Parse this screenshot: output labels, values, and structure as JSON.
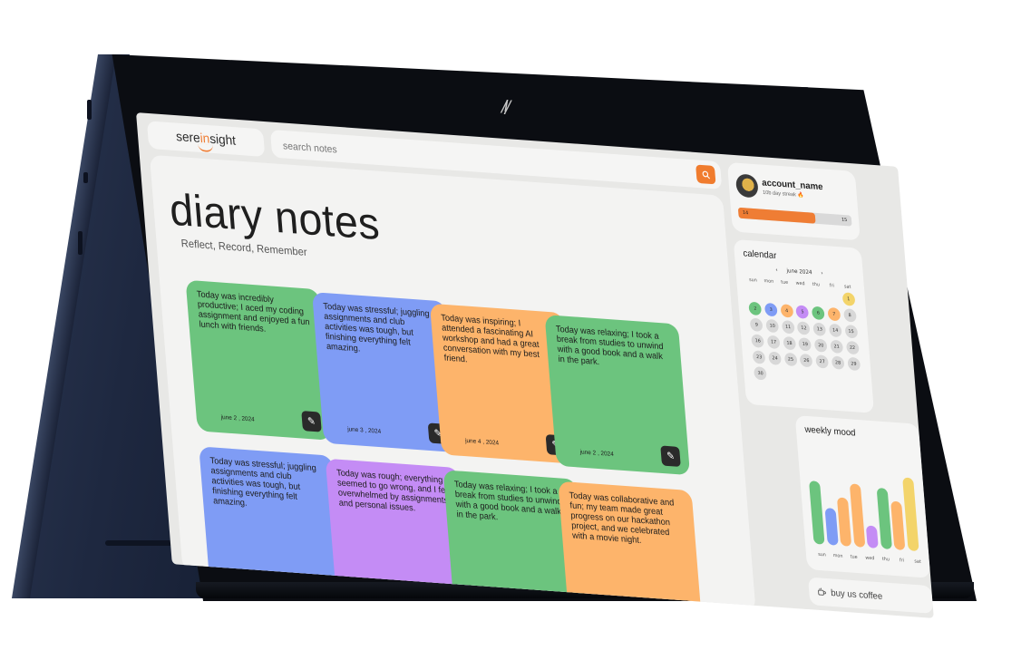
{
  "header": {
    "brand": {
      "pre": "sere",
      "mid": "in",
      "post": "sight"
    },
    "search_placeholder": "search notes",
    "search_icon": "search-icon"
  },
  "main": {
    "title": "diary notes",
    "subtitle": "Reflect, Record, Remember",
    "notes": [
      {
        "text": "Today was incredibly productive; I aced my coding assignment and enjoyed a fun lunch with friends.",
        "date": "june 2 , 2024",
        "color": "#6cc47e"
      },
      {
        "text": "Today was stressful; juggling assignments and club activities was tough, but finishing everything felt amazing.",
        "date": "june 3 , 2024",
        "color": "#7f9cf5"
      },
      {
        "text": "Today was inspiring; I attended a fascinating AI workshop and had a great conversation with my best friend.",
        "date": "june 4 , 2024",
        "color": "#fdb46b"
      },
      {
        "text": "Today was relaxing; I took a break from studies to unwind with a good book and a walk in the park.",
        "date": "june 2 , 2024",
        "color": "#6cc47e"
      },
      {
        "text": "Today was stressful; juggling assignments and club activities was tough, but finishing everything felt amazing.",
        "date": "",
        "color": "#7f9cf5"
      },
      {
        "text": "Today was rough; everything seemed to go wrong, and I felt overwhelmed by assignments and personal issues.",
        "date": "",
        "color": "#c48cf5"
      },
      {
        "text": "Today was relaxing; I took a break from studies to unwind with a good book and a walk in the park.",
        "date": "",
        "color": "#6cc47e"
      },
      {
        "text": "Today was collaborative and fun; my team made great progress on our hackathon project, and we celebrated with a movie night.",
        "date": "",
        "color": "#fdb46b"
      }
    ]
  },
  "account": {
    "name": "account_name",
    "streak": "10b day streak",
    "progress_left": "14",
    "progress_right": "15",
    "progress_fraction": 0.68,
    "accent": "#ef7d34"
  },
  "calendar": {
    "title": "calendar",
    "month": "june 2024",
    "prev_icon": "‹",
    "next_icon": "›",
    "weekdays": [
      "sun",
      "mon",
      "tue",
      "wed",
      "thu",
      "fri",
      "sat"
    ],
    "days": [
      {
        "d": "1",
        "c": "#f3d46a"
      },
      {
        "d": "2",
        "c": "#6cc47e"
      },
      {
        "d": "3",
        "c": "#7f9cf5"
      },
      {
        "d": "4",
        "c": "#fdb46b"
      },
      {
        "d": "5",
        "c": "#c48cf5"
      },
      {
        "d": "6",
        "c": "#6cc47e"
      },
      {
        "d": "7",
        "c": "#fdb46b"
      },
      {
        "d": "8",
        "c": ""
      },
      {
        "d": "9",
        "c": ""
      },
      {
        "d": "10",
        "c": ""
      },
      {
        "d": "11",
        "c": ""
      },
      {
        "d": "12",
        "c": ""
      },
      {
        "d": "13",
        "c": ""
      },
      {
        "d": "14",
        "c": ""
      },
      {
        "d": "15",
        "c": ""
      },
      {
        "d": "16",
        "c": ""
      },
      {
        "d": "17",
        "c": ""
      },
      {
        "d": "18",
        "c": ""
      },
      {
        "d": "19",
        "c": ""
      },
      {
        "d": "20",
        "c": ""
      },
      {
        "d": "21",
        "c": ""
      },
      {
        "d": "22",
        "c": ""
      },
      {
        "d": "23",
        "c": ""
      },
      {
        "d": "24",
        "c": ""
      },
      {
        "d": "25",
        "c": ""
      },
      {
        "d": "26",
        "c": ""
      },
      {
        "d": "27",
        "c": ""
      },
      {
        "d": "28",
        "c": ""
      },
      {
        "d": "29",
        "c": ""
      },
      {
        "d": "30",
        "c": ""
      }
    ]
  },
  "weekly_mood": {
    "title": "weekly mood",
    "labels": [
      "sun",
      "mon",
      "tue",
      "wed",
      "thu",
      "fri",
      "sat"
    ],
    "bars": [
      {
        "v": 0.62,
        "c": "#6cc47e"
      },
      {
        "v": 0.36,
        "c": "#7f9cf5"
      },
      {
        "v": 0.48,
        "c": "#fdb46b"
      },
      {
        "v": 0.62,
        "c": "#fdb46b"
      },
      {
        "v": 0.22,
        "c": "#c48cf5"
      },
      {
        "v": 0.6,
        "c": "#6cc47e"
      },
      {
        "v": 0.48,
        "c": "#fdb46b"
      },
      {
        "v": 0.72,
        "c": "#f3d46a"
      }
    ]
  },
  "coffee": {
    "label": "buy us coffee",
    "icon": "coffee-icon"
  }
}
